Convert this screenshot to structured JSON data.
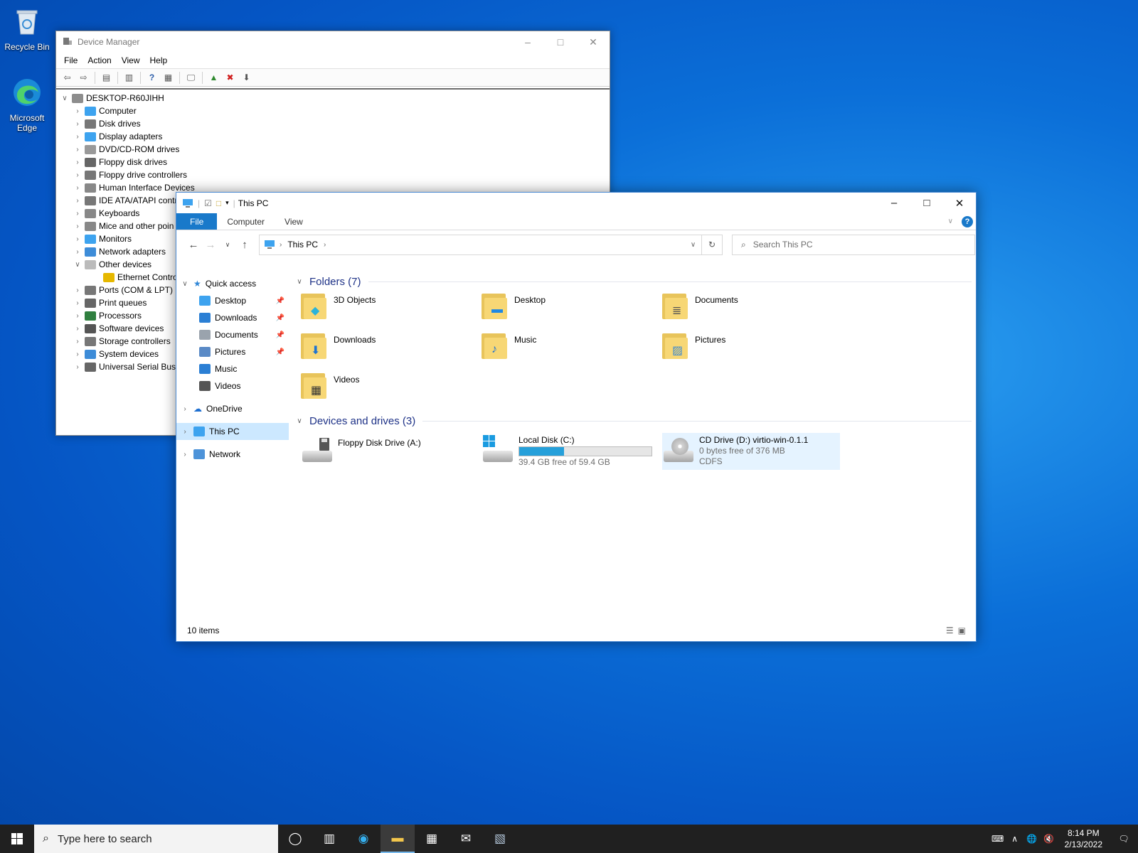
{
  "desktop": {
    "icons": [
      {
        "label": "Recycle Bin"
      },
      {
        "label": "Microsoft Edge"
      }
    ]
  },
  "device_manager": {
    "title": "Device Manager",
    "menu": [
      "File",
      "Action",
      "View",
      "Help"
    ],
    "root": "DESKTOP-R60JIHH",
    "nodes": [
      {
        "label": "Computer",
        "expanded": false
      },
      {
        "label": "Disk drives",
        "expanded": false
      },
      {
        "label": "Display adapters",
        "expanded": false
      },
      {
        "label": "DVD/CD-ROM drives",
        "expanded": false
      },
      {
        "label": "Floppy disk drives",
        "expanded": false
      },
      {
        "label": "Floppy drive controllers",
        "expanded": false
      },
      {
        "label": "Human Interface Devices",
        "expanded": false
      },
      {
        "label": "IDE ATA/ATAPI contr",
        "expanded": false
      },
      {
        "label": "Keyboards",
        "expanded": false
      },
      {
        "label": "Mice and other poin",
        "expanded": false
      },
      {
        "label": "Monitors",
        "expanded": false
      },
      {
        "label": "Network adapters",
        "expanded": false
      },
      {
        "label": "Other devices",
        "expanded": true
      },
      {
        "label": "Ethernet Contro",
        "child": true
      },
      {
        "label": "Ports (COM & LPT)",
        "expanded": false
      },
      {
        "label": "Print queues",
        "expanded": false
      },
      {
        "label": "Processors",
        "expanded": false
      },
      {
        "label": "Software devices",
        "expanded": false
      },
      {
        "label": "Storage controllers",
        "expanded": false
      },
      {
        "label": "System devices",
        "expanded": false
      },
      {
        "label": "Universal Serial Bus",
        "expanded": false
      }
    ]
  },
  "explorer": {
    "title": "This PC",
    "tabs": {
      "file": "File",
      "computer": "Computer",
      "view": "View"
    },
    "address": {
      "crumb": "This PC"
    },
    "search": {
      "placeholder": "Search This PC"
    },
    "nav": {
      "quick_access": "Quick access",
      "quick_items": [
        {
          "label": "Desktop",
          "pinned": true
        },
        {
          "label": "Downloads",
          "pinned": true
        },
        {
          "label": "Documents",
          "pinned": true
        },
        {
          "label": "Pictures",
          "pinned": true
        },
        {
          "label": "Music",
          "pinned": false
        },
        {
          "label": "Videos",
          "pinned": false
        }
      ],
      "onedrive": "OneDrive",
      "this_pc": "This PC",
      "network": "Network"
    },
    "folders_header": "Folders (7)",
    "folders": [
      "3D Objects",
      "Desktop",
      "Documents",
      "Downloads",
      "Music",
      "Pictures",
      "Videos"
    ],
    "drives_header": "Devices and drives (3)",
    "drives": [
      {
        "name": "Floppy Disk Drive (A:)"
      },
      {
        "name": "Local Disk (C:)",
        "free": "39.4 GB free of 59.4 GB",
        "used_fraction": 0.34
      },
      {
        "name": "CD Drive (D:) virtio-win-0.1.1",
        "free": "0 bytes free of 376 MB",
        "fs": "CDFS"
      }
    ],
    "status": "10 items"
  },
  "taskbar": {
    "search_placeholder": "Type here to search",
    "time": "8:14 PM",
    "date": "2/13/2022"
  },
  "colors": {
    "accent": "#1979ca",
    "capacity_fill": "#26a0da",
    "selection": "#cce8ff"
  }
}
